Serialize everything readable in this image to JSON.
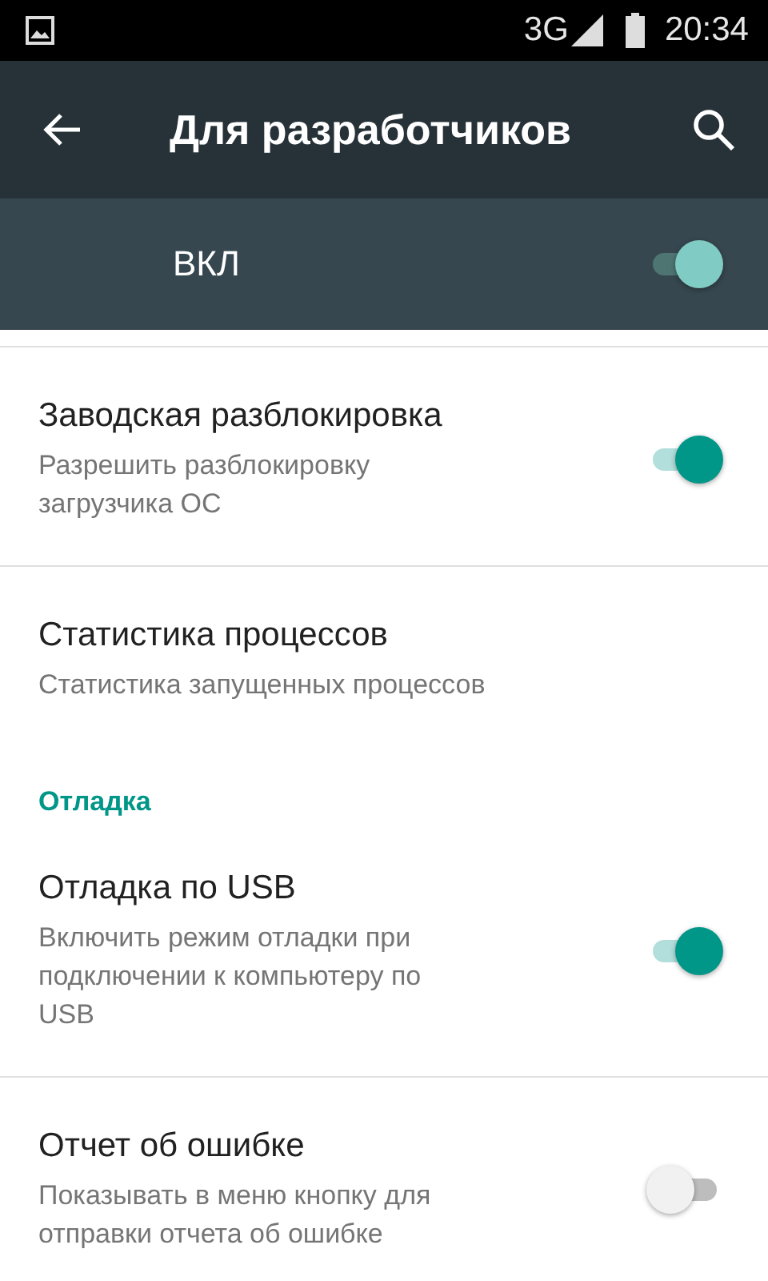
{
  "status_bar": {
    "network": "3G",
    "time": "20:34"
  },
  "toolbar": {
    "title": "Для разработчиков"
  },
  "master_switch": {
    "label": "ВКЛ",
    "on": true
  },
  "items": [
    {
      "kind": "switch",
      "title": "Заводская разблокировка",
      "summary": "Разрешить разблокировку загрузчика ОС",
      "on": true,
      "divider": true
    },
    {
      "kind": "text",
      "title": "Статистика процессов",
      "summary": "Статистика запущенных процессов",
      "divider": false
    },
    {
      "kind": "category",
      "title": "Отладка"
    },
    {
      "kind": "switch",
      "title": "Отладка по USB",
      "summary": "Включить режим отладки при подключении к компьютеру по USB",
      "on": true,
      "divider": true
    },
    {
      "kind": "switch",
      "title": "Отчет об ошибке",
      "summary": "Показывать в меню кнопку для отправки отчета об ошибке",
      "on": false,
      "divider": false
    }
  ]
}
